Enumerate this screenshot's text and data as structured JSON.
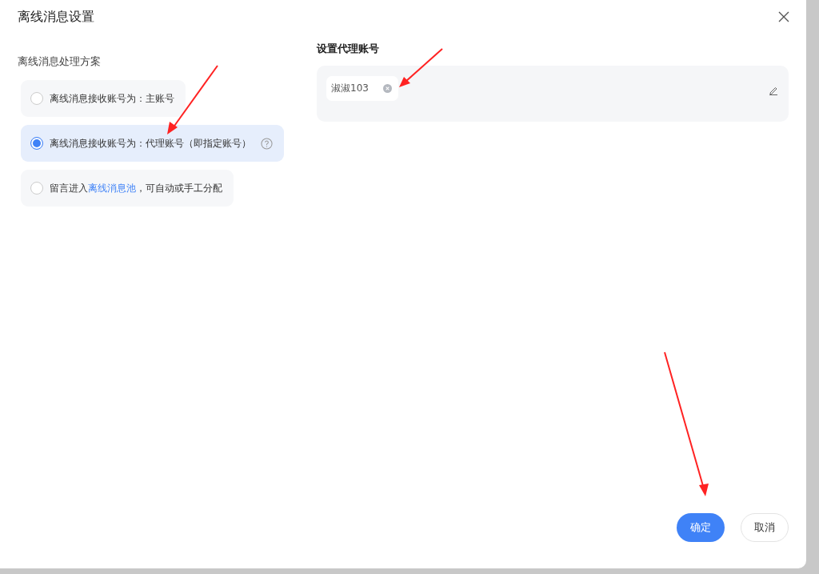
{
  "dialog": {
    "title": "离线消息设置"
  },
  "scheme": {
    "heading": "离线消息处理方案",
    "options": [
      {
        "selected": false,
        "text": "离线消息接收账号为：主账号",
        "help": false
      },
      {
        "selected": true,
        "text": "离线消息接收账号为：代理账号（即指定账号）",
        "help": true
      },
      {
        "selected": false,
        "text": "留言进入",
        "link": "离线消息池",
        "after": "，可自动或手工分配",
        "help": false
      }
    ]
  },
  "proxy": {
    "heading": "设置代理账号",
    "tags": [
      "淑淑103"
    ]
  },
  "buttons": [
    {
      "label": "确定",
      "kind": "primary"
    },
    {
      "label": "取消",
      "kind": "default"
    }
  ]
}
